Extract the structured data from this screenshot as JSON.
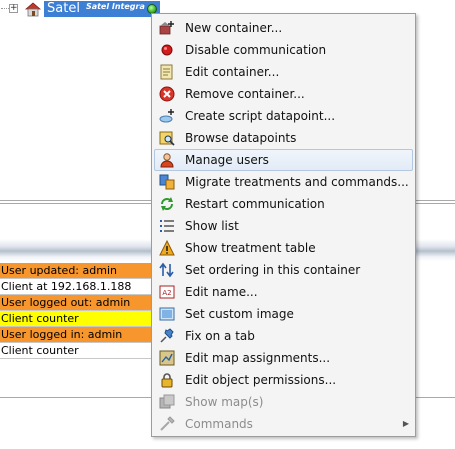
{
  "tree": {
    "node_label": "Satel",
    "node_sublabel": "Satel Integra",
    "expander_symbol": "+",
    "node_icon": "house-icon",
    "status_icon": "green-status-dot-icon"
  },
  "log": {
    "rows": [
      {
        "text": "User updated: admin",
        "color": "#f7962d"
      },
      {
        "text": "Client at 192.168.1.188",
        "color": "#ffffff"
      },
      {
        "text": "User logged out: admin",
        "color": "#f7962d"
      },
      {
        "text": "Client counter",
        "color": "#ffff00"
      },
      {
        "text": "User logged in: admin",
        "color": "#f7962d"
      },
      {
        "text": "Client counter",
        "color": "#ffffff"
      }
    ]
  },
  "menu": {
    "items": [
      {
        "label": "New container...",
        "icon": "new-container-icon",
        "enabled": true
      },
      {
        "label": "Disable communication",
        "icon": "red-dot-icon",
        "enabled": true
      },
      {
        "label": "Edit container...",
        "icon": "edit-container-icon",
        "enabled": true
      },
      {
        "label": "Remove container...",
        "icon": "remove-icon",
        "enabled": true
      },
      {
        "label": "Create script datapoint...",
        "icon": "script-datapoint-icon",
        "enabled": true
      },
      {
        "label": "Browse datapoints",
        "icon": "browse-datapoints-icon",
        "enabled": true
      },
      {
        "label": "Manage users",
        "icon": "user-icon",
        "enabled": true,
        "highlighted": true
      },
      {
        "label": "Migrate treatments and commands...",
        "icon": "migrate-icon",
        "enabled": true
      },
      {
        "label": "Restart communication",
        "icon": "restart-icon",
        "enabled": true
      },
      {
        "label": "Show list",
        "icon": "list-icon",
        "enabled": true
      },
      {
        "label": "Show treatment table",
        "icon": "warning-icon",
        "enabled": true
      },
      {
        "label": "Set ordering in this container",
        "icon": "ordering-icon",
        "enabled": true
      },
      {
        "label": "Edit name...",
        "icon": "edit-name-icon",
        "enabled": true
      },
      {
        "label": "Set custom image",
        "icon": "image-icon",
        "enabled": true
      },
      {
        "label": "Fix on a tab",
        "icon": "pin-icon",
        "enabled": true
      },
      {
        "label": "Edit map assignments...",
        "icon": "map-icon",
        "enabled": true
      },
      {
        "label": "Edit object permissions...",
        "icon": "lock-icon",
        "enabled": true
      },
      {
        "label": "Show map(s)",
        "icon": "maps-icon",
        "enabled": false
      },
      {
        "label": "Commands",
        "icon": "commands-icon",
        "enabled": false,
        "submenu": true
      }
    ],
    "submenu_arrow": "▶"
  }
}
